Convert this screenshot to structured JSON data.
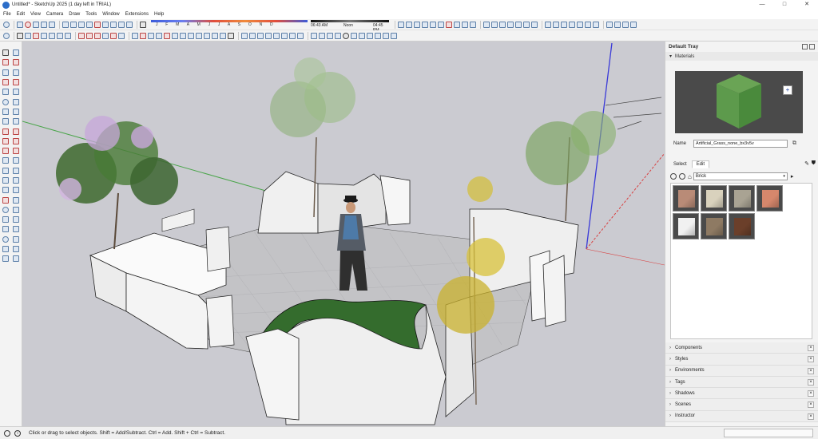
{
  "window": {
    "title": "Untitled* - SketchUp 2025 (1 day left in TRIAL)",
    "minimize": "—",
    "maximize": "□",
    "close": "✕"
  },
  "menu": [
    "File",
    "Edit",
    "View",
    "Camera",
    "Draw",
    "Tools",
    "Window",
    "Extensions",
    "Help"
  ],
  "shadow_settings": {
    "months": "J F M A M J J A S O N D",
    "sunrise": "06:43 AM",
    "noon": "Noon",
    "sunset": "04:45 PM"
  },
  "tray": {
    "title": "Default Tray",
    "materials_panel": "Materials",
    "name_label": "Name",
    "material_name": "Artificial_Grass_none_bx3v5v",
    "tab_select": "Select",
    "tab_edit": "Edit",
    "library": "Brick",
    "swatch_colors": [
      "#b98b77",
      "#d9d2bd",
      "#a9a393",
      "#d6876c",
      "#f1f1f1",
      "#8e7a63",
      "#6b3f2a"
    ],
    "preview_color": "#6aa455",
    "collapsed_panels": [
      "Components",
      "Styles",
      "Environments",
      "Tags",
      "Shadows",
      "Scenes",
      "Instructor"
    ]
  },
  "status": {
    "message": "Click or drag to select objects. Shift = Add/Subtract. Ctrl = Add. Shift + Ctrl = Subtract."
  }
}
